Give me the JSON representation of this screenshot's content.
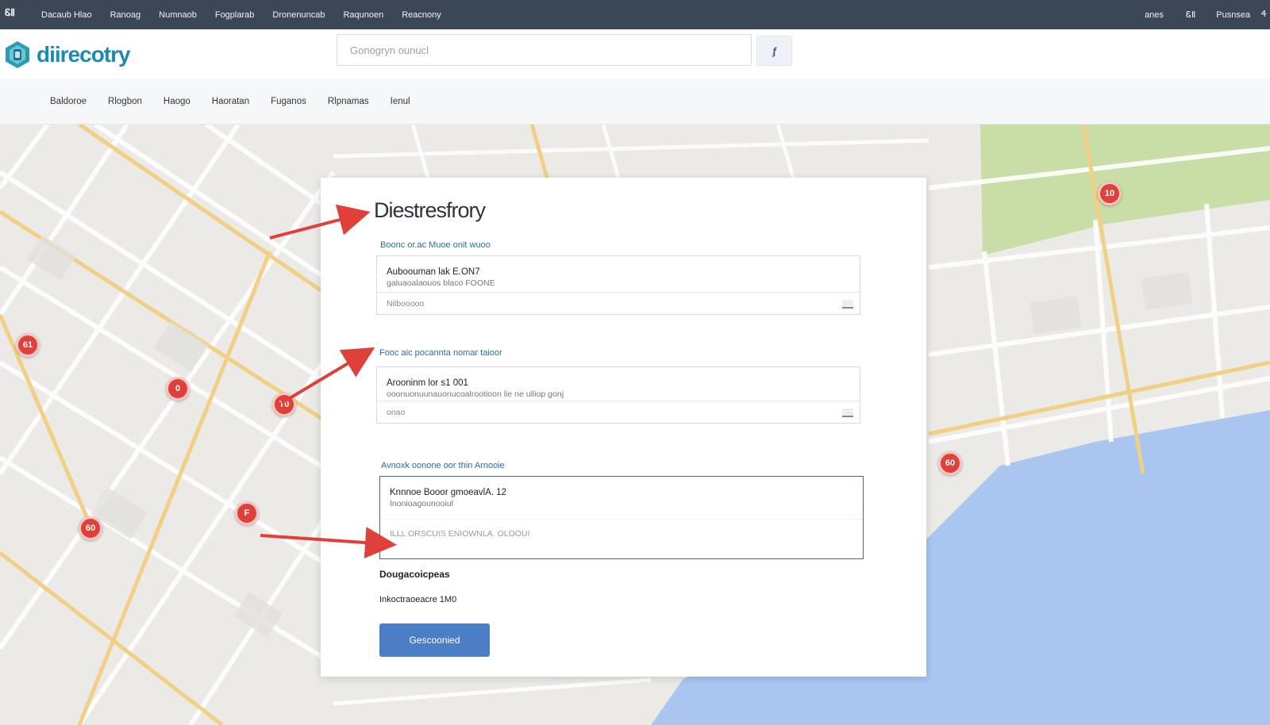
{
  "topbar": {
    "brand": "ᏋⅡ",
    "links": [
      "Dacaub Hlao",
      "Ranoag",
      "Numnaob",
      "Fogplarab",
      "Dronenuncab",
      "Raqunoen",
      "Reacnony"
    ],
    "right": [
      "anes",
      "ᏋⅡ",
      "Pusnsea",
      "Ꮞ"
    ]
  },
  "header": {
    "logo_text": "diirecotry",
    "search_placeholder": "Gonogryn ounucl",
    "search_button_glyph": "ᶂ"
  },
  "subnav": {
    "items": [
      "Baldoroe",
      "Rlogbon",
      "Haogo",
      "Haoratan",
      "Fuganos",
      "Rlpnamas",
      "Ienul"
    ]
  },
  "map": {
    "pins": [
      "61",
      "0",
      "T0",
      "60",
      "F",
      "10",
      "60"
    ],
    "colors": {
      "water": "#a8c6ef",
      "park": "#c9dea6",
      "road_major": "#f1cf84",
      "land": "#eceae6"
    }
  },
  "panel": {
    "title": "Diestresfrory",
    "sections": [
      {
        "label": "Boonc or.ac Muoe onit wuoo",
        "line1": "Auboouman lak E.ON7",
        "line2": "galuaoalaouos blaco FOONE",
        "field": "Nilbooooo"
      },
      {
        "label": "Fooc aic pocannta nomar taioor",
        "line1": "Arooninm lor s1 001",
        "line2": "ooonuonuunauonucoalrootioon lie ne ulliop gonj",
        "field": "onao"
      },
      {
        "label": "Avnoxk oonone oor thin Arnooie",
        "line1": "Knnnoe Booor gmoeavlA. 12",
        "line2": "Inonioagounooiul",
        "field": "ILLL ORSCUIS ENIOWNLA. OLOOUI"
      }
    ],
    "meta1": "Dougacoicpeas",
    "meta2": "Inkoctraoeacre 1M0",
    "submit_label": "Gescoonied"
  }
}
